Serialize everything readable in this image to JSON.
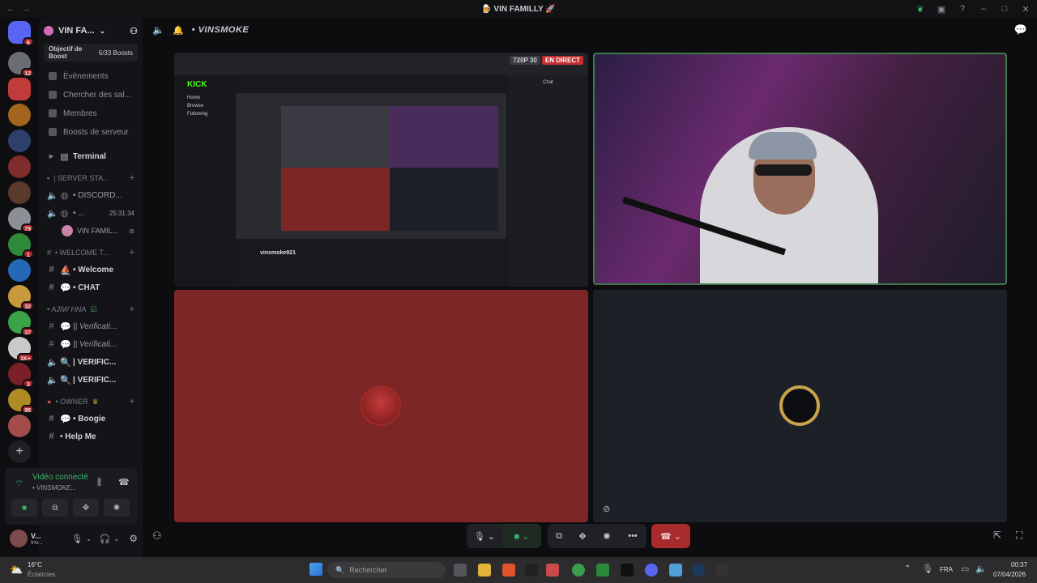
{
  "window": {
    "title": "🍺 VIN FAMILLY 🚀"
  },
  "guild_badges": [
    "6",
    "12",
    "79",
    "1",
    "32",
    "37",
    "1K+",
    "3",
    "95"
  ],
  "server": {
    "name": "VIN FA...",
    "boost_label": "Objectif de Boost",
    "boost_count": "6/33 Boosts"
  },
  "menu": [
    "Évènements",
    "Chercher des sal...",
    "Membres",
    "Boosts de serveur"
  ],
  "channels": {
    "terminal": "Terminal",
    "cat_server_stats": "| SERVER STA...",
    "discord": "• DISCORD...",
    "stat2": "• ...",
    "stat2_time": "25:31:34",
    "voice_user": "VIN FAMIL...",
    "cat_welcome": "• WELCOME T...",
    "welcome": "• Welcome",
    "chat": "• CHAT",
    "cat_ajiw": "• AJIW HNA",
    "verif1": "|| Verificati...",
    "verif2": "|| Verificati...",
    "verif3": "| VERIFIC...",
    "verif4": "| VERIFIC...",
    "cat_owner": "• OWNER",
    "boogie": "• Boogie",
    "help": "• Help Me"
  },
  "voice": {
    "status": "Vidéo connecté",
    "channel": "• VINSMOKE..."
  },
  "user": {
    "name": "V...",
    "status": "Inv..."
  },
  "call": {
    "channel_name": "• VINSMOKE",
    "quality": "720P 30",
    "live_label": "EN DIRECT"
  },
  "stream": {
    "brand": "KICK",
    "streamer": "vinsmoke921",
    "nav": [
      "Home",
      "Browse",
      "Following"
    ],
    "chat_title": "Chat"
  },
  "taskbar": {
    "weather_temp": "16°C",
    "weather_desc": "Éclaircies",
    "search_placeholder": "Rechercher",
    "lang": "FRA",
    "time": "00:37",
    "date": "07/04/2026"
  }
}
